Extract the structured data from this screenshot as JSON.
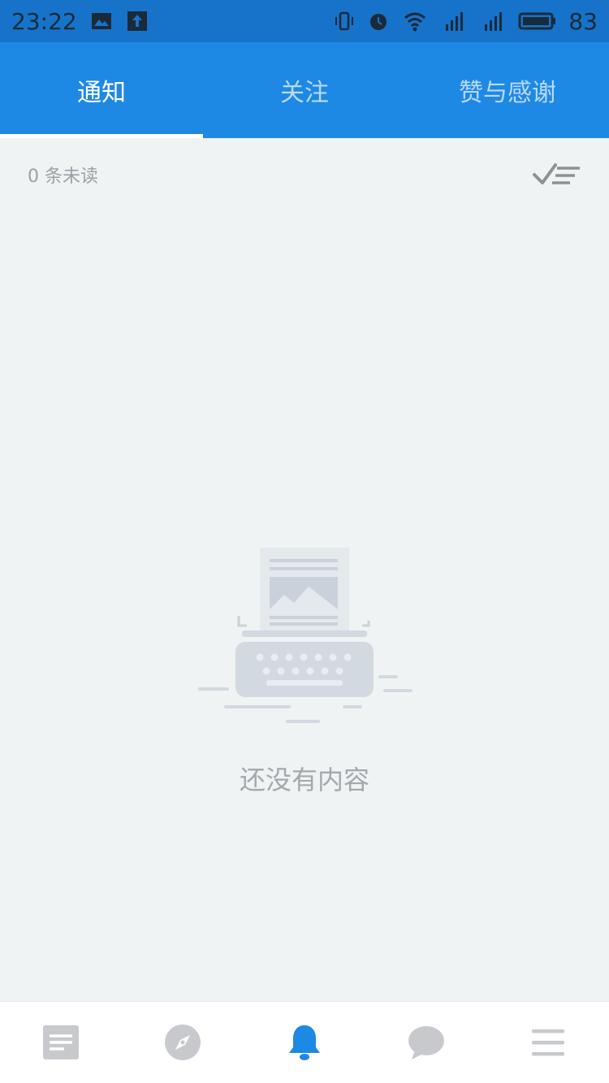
{
  "status_bar": {
    "time": "23:22",
    "battery": "83"
  },
  "tabs": [
    {
      "label": "通知",
      "active": true
    },
    {
      "label": "关注",
      "active": false
    },
    {
      "label": "赞与感谢",
      "active": false
    }
  ],
  "unread": {
    "text": "0 条未读"
  },
  "empty_state": {
    "text": "还没有内容"
  },
  "colors": {
    "accent": "#1e88e5",
    "status_bar": "#1773c9",
    "background": "#f0f3f4",
    "nav_active": "#1e88e5",
    "nav_inactive": "#c7c9cc"
  },
  "bottom_nav": {
    "items": [
      {
        "icon": "feed-icon"
      },
      {
        "icon": "compass-icon"
      },
      {
        "icon": "bell-icon",
        "active": true
      },
      {
        "icon": "chat-bubble-icon"
      },
      {
        "icon": "menu-icon"
      }
    ]
  }
}
